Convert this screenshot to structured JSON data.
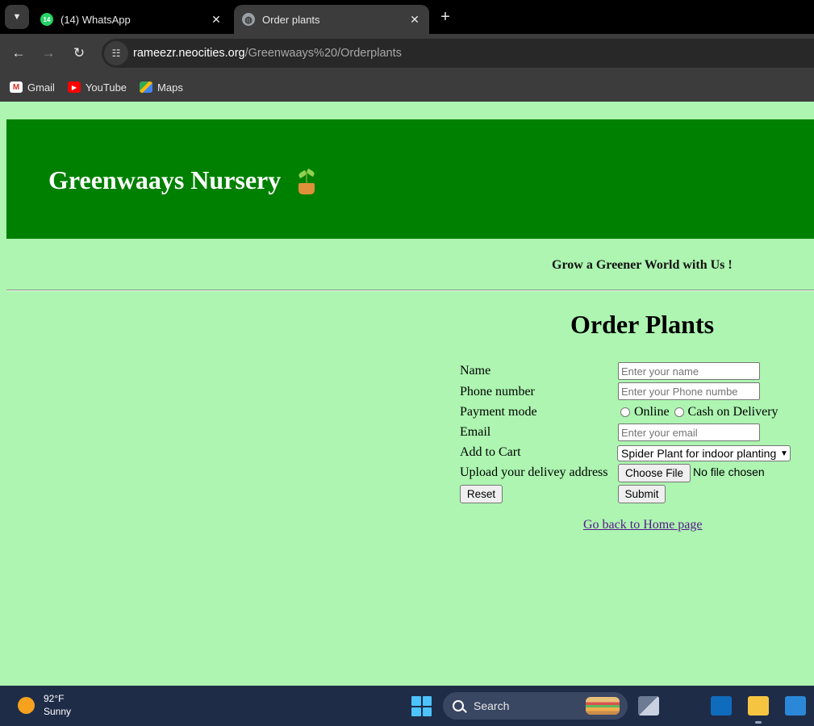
{
  "browser": {
    "tabs": [
      {
        "title": "(14) WhatsApp",
        "badge": "14",
        "active": false
      },
      {
        "title": "Order plants",
        "active": true
      }
    ],
    "close_glyph": "✕",
    "new_tab_glyph": "+",
    "url": {
      "host": "rameezr.neocities.org",
      "path": "/Greenwaays%20/Orderplants"
    },
    "bookmarks": [
      {
        "label": "Gmail",
        "icon": "gmail-icon"
      },
      {
        "label": "YouTube",
        "icon": "youtube-icon"
      },
      {
        "label": "Maps",
        "icon": "maps-icon"
      }
    ]
  },
  "page": {
    "colors": {
      "background": "#adf5b1",
      "header": "#008000",
      "header_text": "#ffffff",
      "link": "#551a8b"
    },
    "site_title": "Greenwaays Nursery",
    "tagline": "Grow a Greener World with Us !",
    "form": {
      "heading": "Order Plants",
      "name": {
        "label": "Name",
        "placeholder": "Enter your name",
        "value": ""
      },
      "phone": {
        "label": "Phone number",
        "placeholder": "Enter your Phone numbe",
        "value": ""
      },
      "payment": {
        "label": "Payment mode",
        "options": [
          "Online",
          "Cash on Delivery"
        ],
        "selected": null
      },
      "email": {
        "label": "Email",
        "placeholder": "Enter your email",
        "value": ""
      },
      "cart": {
        "label": "Add to Cart",
        "selected": "Spider Plant for indoor planting"
      },
      "upload": {
        "label": "Upload your delivey address",
        "button": "Choose File",
        "status": "No file chosen"
      },
      "reset_label": "Reset",
      "submit_label": "Submit"
    },
    "home_link": "Go back to Home page"
  },
  "taskbar": {
    "weather": {
      "temp": "92°F",
      "condition": "Sunny"
    },
    "search_label": "Search"
  }
}
